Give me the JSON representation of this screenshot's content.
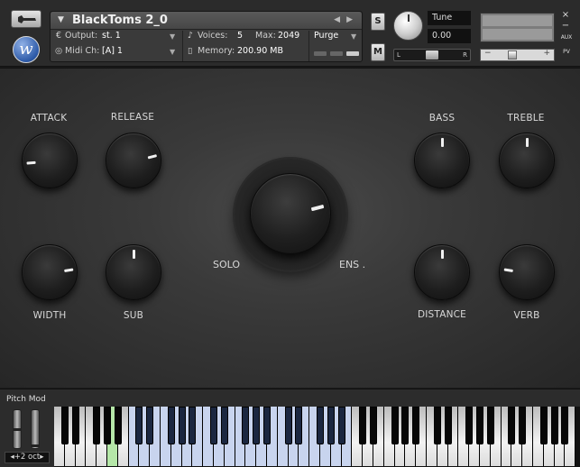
{
  "header": {
    "instrument_title": "BlackToms 2_0",
    "output_label": "Output:",
    "output_value": "st. 1",
    "voices_label": "Voices:",
    "voices_value": "5",
    "max_label": "Max:",
    "max_value": "2049",
    "purge_label": "Purge",
    "midi_label": "Midi Ch:",
    "midi_value": "[A]  1",
    "memory_label": "Memory:",
    "memory_value": "200.90 MB",
    "logo_letter": "w",
    "solo_button": "S",
    "mute_button": "M",
    "tune_label": "Tune",
    "tune_value": "0.00",
    "pan_left": "L",
    "pan_right": "R",
    "vol_minus": "−",
    "vol_plus": "+",
    "close_btn": "×",
    "min_btn": "−",
    "aux_label": "AUX",
    "pv_label": "PV"
  },
  "knobs": {
    "attack": {
      "label": "ATTACK",
      "value": 0.15
    },
    "release": {
      "label": "RELEASE",
      "value": 0.78
    },
    "bass": {
      "label": "BASS",
      "value": 0.5
    },
    "treble": {
      "label": "TREBLE",
      "value": 0.5
    },
    "width": {
      "label": "WIDTH",
      "value": 0.8
    },
    "sub": {
      "label": "SUB",
      "value": 0.5
    },
    "distance": {
      "label": "DISTANCE",
      "value": 0.5
    },
    "verb": {
      "label": "VERB",
      "value": 0.2
    },
    "mix": {
      "value": 0.78
    }
  },
  "mix_labels": {
    "solo": "SOLO",
    "ens": "ENS ."
  },
  "bottom": {
    "pitchmod_label": "Pitch Mod",
    "octave_value": "+2 oct"
  },
  "colors": {
    "key_highlight_blue": "#c8d4ee",
    "key_pressed_green": "#b5e7a8"
  }
}
